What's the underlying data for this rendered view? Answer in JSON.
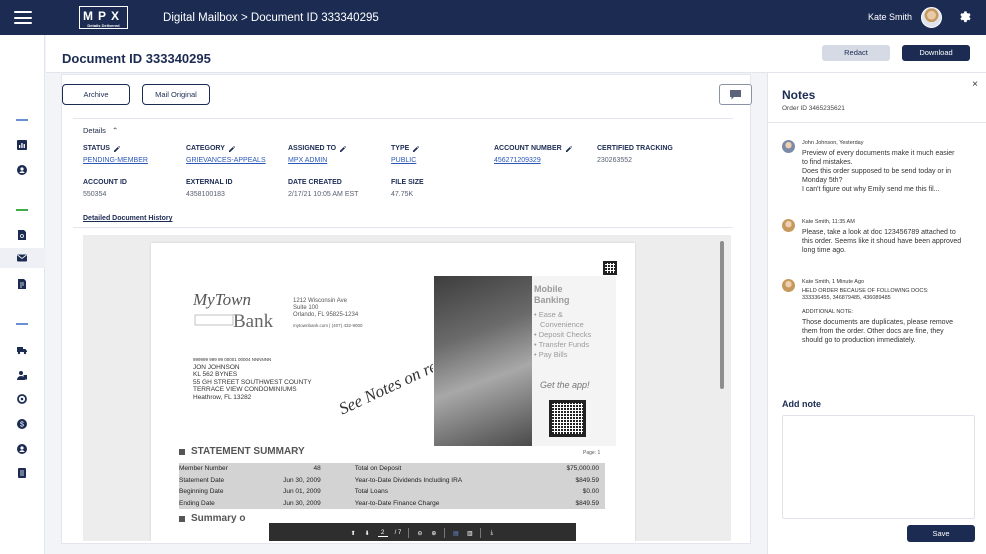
{
  "app": {
    "brand": "MPX",
    "brand_tagline": "Details Delivered",
    "breadcrumb": "Digital Mailbox > Document ID 333340295",
    "user_name": "Kate Smith"
  },
  "header": {
    "title": "Document ID 333340295",
    "redact_label": "Redact",
    "download_label": "Download"
  },
  "actions": {
    "archive_label": "Archive",
    "mail_original_label": "Mail Original"
  },
  "details": {
    "toggle_label": "Details",
    "status": {
      "label": "STATUS",
      "value": "PENDING-MEMBER"
    },
    "category": {
      "label": "CATEGORY",
      "value": "GRIEVANCES-APPEALS"
    },
    "assigned_to": {
      "label": "ASSIGNED TO",
      "value": "MPX ADMIN"
    },
    "type": {
      "label": "TYPE",
      "value": "PUBLIC"
    },
    "account_number": {
      "label": "ACCOUNT NUMBER",
      "value": "456271209329"
    },
    "certified_tracking": {
      "label": "CERTIFIED TRACKING",
      "value": "230263552"
    },
    "account_id": {
      "label": "ACCOUNT ID",
      "value": "550354"
    },
    "external_id": {
      "label": "EXTERNAL ID",
      "value": "4358100183"
    },
    "date_created": {
      "label": "DATE CREATED",
      "value": "2/17/21 10:05 AM EST"
    },
    "file_size": {
      "label": "FILE SIZE",
      "value": "47.75K"
    },
    "history_link": "Detailed Document History"
  },
  "document": {
    "bank_name_1": "MyTown",
    "bank_name_2": "Bank",
    "bank_address": [
      "1212 Wisconsin Ave",
      "Suite 100",
      "Orlando, FL 95825-1234"
    ],
    "bank_web": "mytownbank.com | (407) 432-9000",
    "customer_code": "999999 999 99 00001 00004 NNNNNN",
    "customer_lines": [
      "JON JOHNSON",
      "KL 562 BYNES",
      "55 GH STREET SOUTHWEST COUNTY",
      "TERRACE VIEW CONDOMINIUMS",
      "Heathrow, FL 13282"
    ],
    "handwriting": "See Notes on reverse",
    "promo_title": [
      "Mobile",
      "Banking"
    ],
    "promo_items": [
      "• Ease &",
      "Convenience",
      "• Deposit Checks",
      "• Transfer Funds",
      "• Pay Bills"
    ],
    "promo_cta": "Get the app!",
    "page_label": "Page: 1",
    "summary_title": "STATEMENT SUMMARY",
    "summary_rows": [
      [
        "Member Number",
        "48",
        "Total on Deposit",
        "$75,000.00"
      ],
      [
        "Statement Date",
        "Jun 30, 2009",
        "Year-to-Date Dividends Including IRA",
        "$849.59"
      ],
      [
        "Beginning Date",
        "Jun 01, 2009",
        "Total Loans",
        "$0.00"
      ],
      [
        "Ending Date",
        "Jun 30, 2009",
        "Year-to-Date Finance Charge",
        "$849.59"
      ]
    ],
    "summary2_title": "Summary o",
    "pdf_page": "2",
    "pdf_total": "/ 7"
  },
  "notes": {
    "title": "Notes",
    "order_id": "Order ID 3465235621",
    "items": [
      {
        "meta": "John Johnson, Yesterday",
        "body": [
          "Preview of every documents make it much easier",
          "to find mistakes.",
          "Does this order supposed to be send today or in",
          "Monday 5th?",
          "I can't figure out why Emily send me this fil..."
        ]
      },
      {
        "meta": "Kate Smith, 11:35 AM",
        "body": [
          "Please, take a look at doc 123456789 attached to",
          "this order. Seems like it shoud have been approved",
          "long time ago."
        ]
      },
      {
        "meta": "Kate Smith, 1 Minute Ago",
        "body_small": [
          "HELD ORDER BECAUSE OF FOLLOWING DOCS:",
          "333336455, 346879485, 436089485",
          "",
          "ADDITIONAL NOTE:"
        ],
        "body": [
          "Those documents are duplicates, please remove",
          "them from the order. Other docs are fine, they",
          "should go to production immediately."
        ]
      }
    ],
    "add_note_label": "Add note",
    "add_note_value": "",
    "save_label": "Save",
    "close_label": "×"
  },
  "colors": {
    "navy": "#1b2b52",
    "accent_green": "#3fae49",
    "accent_blue": "#6b8fd4"
  }
}
